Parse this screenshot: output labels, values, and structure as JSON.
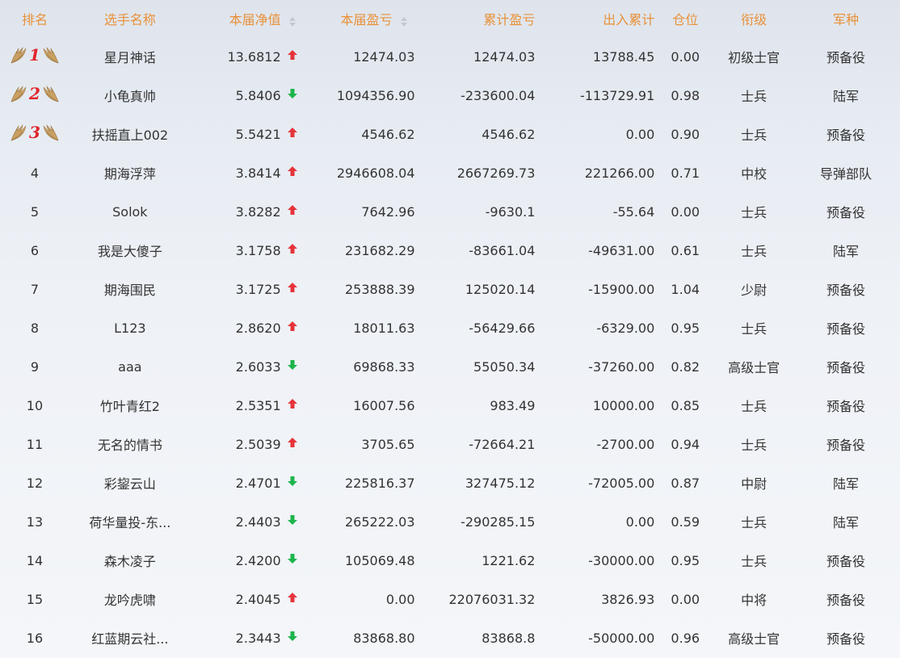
{
  "header": {
    "rank": "排名",
    "name": "选手名称",
    "net": "本届净值",
    "profit": "本届盈亏",
    "total": "累计盈亏",
    "flow": "出入累计",
    "position": "仓位",
    "title": "衔级",
    "army": "军种"
  },
  "colors": {
    "header": "#e8913a",
    "up": "#e6333a",
    "down": "#1db54b",
    "medal": "#e0262c"
  },
  "rows": [
    {
      "rank": "1",
      "name": "星月神话",
      "net": "13.6812",
      "trend": "up",
      "profit": "12474.03",
      "total": "12474.03",
      "flow": "13788.45",
      "position": "0.00",
      "title": "初级士官",
      "army": "预备役"
    },
    {
      "rank": "2",
      "name": "小龟真帅",
      "net": "5.8406",
      "trend": "down",
      "profit": "1094356.90",
      "total": "-233600.04",
      "flow": "-113729.91",
      "position": "0.98",
      "title": "士兵",
      "army": "陆军"
    },
    {
      "rank": "3",
      "name": "扶摇直上002",
      "net": "5.5421",
      "trend": "up",
      "profit": "4546.62",
      "total": "4546.62",
      "flow": "0.00",
      "position": "0.90",
      "title": "士兵",
      "army": "预备役"
    },
    {
      "rank": "4",
      "name": "期海浮萍",
      "net": "3.8414",
      "trend": "up",
      "profit": "2946608.04",
      "total": "2667269.73",
      "flow": "221266.00",
      "position": "0.71",
      "title": "中校",
      "army": "导弹部队"
    },
    {
      "rank": "5",
      "name": "Solok",
      "net": "3.8282",
      "trend": "up",
      "profit": "7642.96",
      "total": "-9630.1",
      "flow": "-55.64",
      "position": "0.00",
      "title": "士兵",
      "army": "预备役"
    },
    {
      "rank": "6",
      "name": "我是大傻子",
      "net": "3.1758",
      "trend": "up",
      "profit": "231682.29",
      "total": "-83661.04",
      "flow": "-49631.00",
      "position": "0.61",
      "title": "士兵",
      "army": "陆军"
    },
    {
      "rank": "7",
      "name": "期海围民",
      "net": "3.1725",
      "trend": "up",
      "profit": "253888.39",
      "total": "125020.14",
      "flow": "-15900.00",
      "position": "1.04",
      "title": "少尉",
      "army": "预备役"
    },
    {
      "rank": "8",
      "name": "L123",
      "net": "2.8620",
      "trend": "up",
      "profit": "18011.63",
      "total": "-56429.66",
      "flow": "-6329.00",
      "position": "0.95",
      "title": "士兵",
      "army": "预备役"
    },
    {
      "rank": "9",
      "name": "aaa",
      "net": "2.6033",
      "trend": "down",
      "profit": "69868.33",
      "total": "55050.34",
      "flow": "-37260.00",
      "position": "0.82",
      "title": "高级士官",
      "army": "预备役"
    },
    {
      "rank": "10",
      "name": "竹叶青红2",
      "net": "2.5351",
      "trend": "up",
      "profit": "16007.56",
      "total": "983.49",
      "flow": "10000.00",
      "position": "0.85",
      "title": "士兵",
      "army": "预备役"
    },
    {
      "rank": "11",
      "name": "无名的情书",
      "net": "2.5039",
      "trend": "up",
      "profit": "3705.65",
      "total": "-72664.21",
      "flow": "-2700.00",
      "position": "0.94",
      "title": "士兵",
      "army": "预备役"
    },
    {
      "rank": "12",
      "name": "彩鋆云山",
      "net": "2.4701",
      "trend": "down",
      "profit": "225816.37",
      "total": "327475.12",
      "flow": "-72005.00",
      "position": "0.87",
      "title": "中尉",
      "army": "陆军"
    },
    {
      "rank": "13",
      "name": "荷华量投-东...",
      "net": "2.4403",
      "trend": "down",
      "profit": "265222.03",
      "total": "-290285.15",
      "flow": "0.00",
      "position": "0.59",
      "title": "士兵",
      "army": "陆军"
    },
    {
      "rank": "14",
      "name": "森木凌子",
      "net": "2.4200",
      "trend": "down",
      "profit": "105069.48",
      "total": "1221.62",
      "flow": "-30000.00",
      "position": "0.95",
      "title": "士兵",
      "army": "预备役"
    },
    {
      "rank": "15",
      "name": "龙吟虎啸",
      "net": "2.4045",
      "trend": "up",
      "profit": "0.00",
      "total": "22076031.32",
      "flow": "3826.93",
      "position": "0.00",
      "title": "中将",
      "army": "预备役"
    },
    {
      "rank": "16",
      "name": "红蓝期云社...",
      "net": "2.3443",
      "trend": "down",
      "profit": "83868.80",
      "total": "83868.8",
      "flow": "-50000.00",
      "position": "0.96",
      "title": "高级士官",
      "army": "预备役"
    }
  ]
}
